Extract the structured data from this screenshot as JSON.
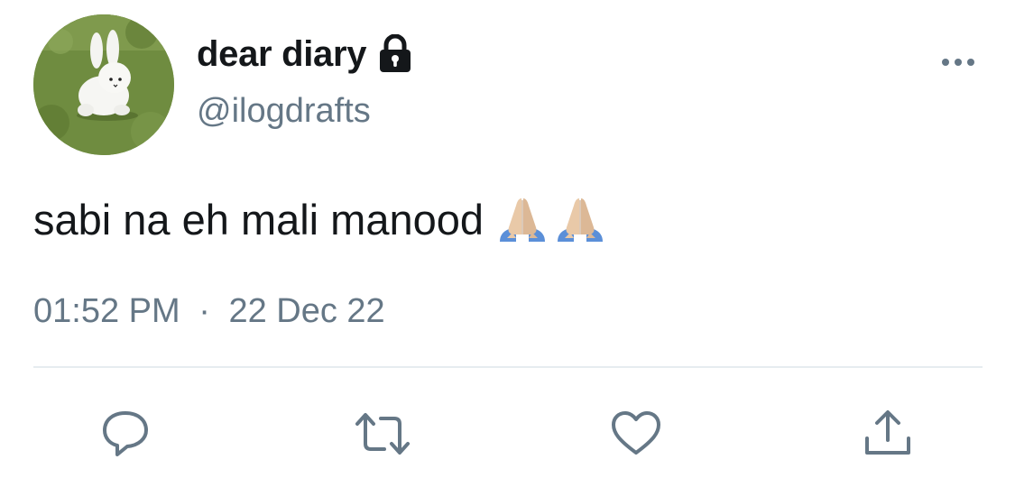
{
  "tweet": {
    "author": {
      "display_name": "dear diary",
      "handle": "@ilogdrafts",
      "protected_icon": "lock-icon",
      "avatar": "avatar-white-bunny-on-grass"
    },
    "text": "sabi na eh mali manood",
    "emojis": [
      "folded-hands-light-skin-tone",
      "folded-hands-light-skin-tone"
    ],
    "time": "01:52 PM",
    "separator": "·",
    "date": "22 Dec 22",
    "menu_icon": "more-horizontal-icon"
  },
  "actions": [
    {
      "name": "reply",
      "icon": "reply-icon"
    },
    {
      "name": "retweet",
      "icon": "retweet-icon"
    },
    {
      "name": "like",
      "icon": "heart-icon"
    },
    {
      "name": "share",
      "icon": "share-icon"
    }
  ],
  "colors": {
    "text_primary": "#14171a",
    "text_secondary": "#657786",
    "divider": "#e6ecf0",
    "icon": "#657786"
  }
}
